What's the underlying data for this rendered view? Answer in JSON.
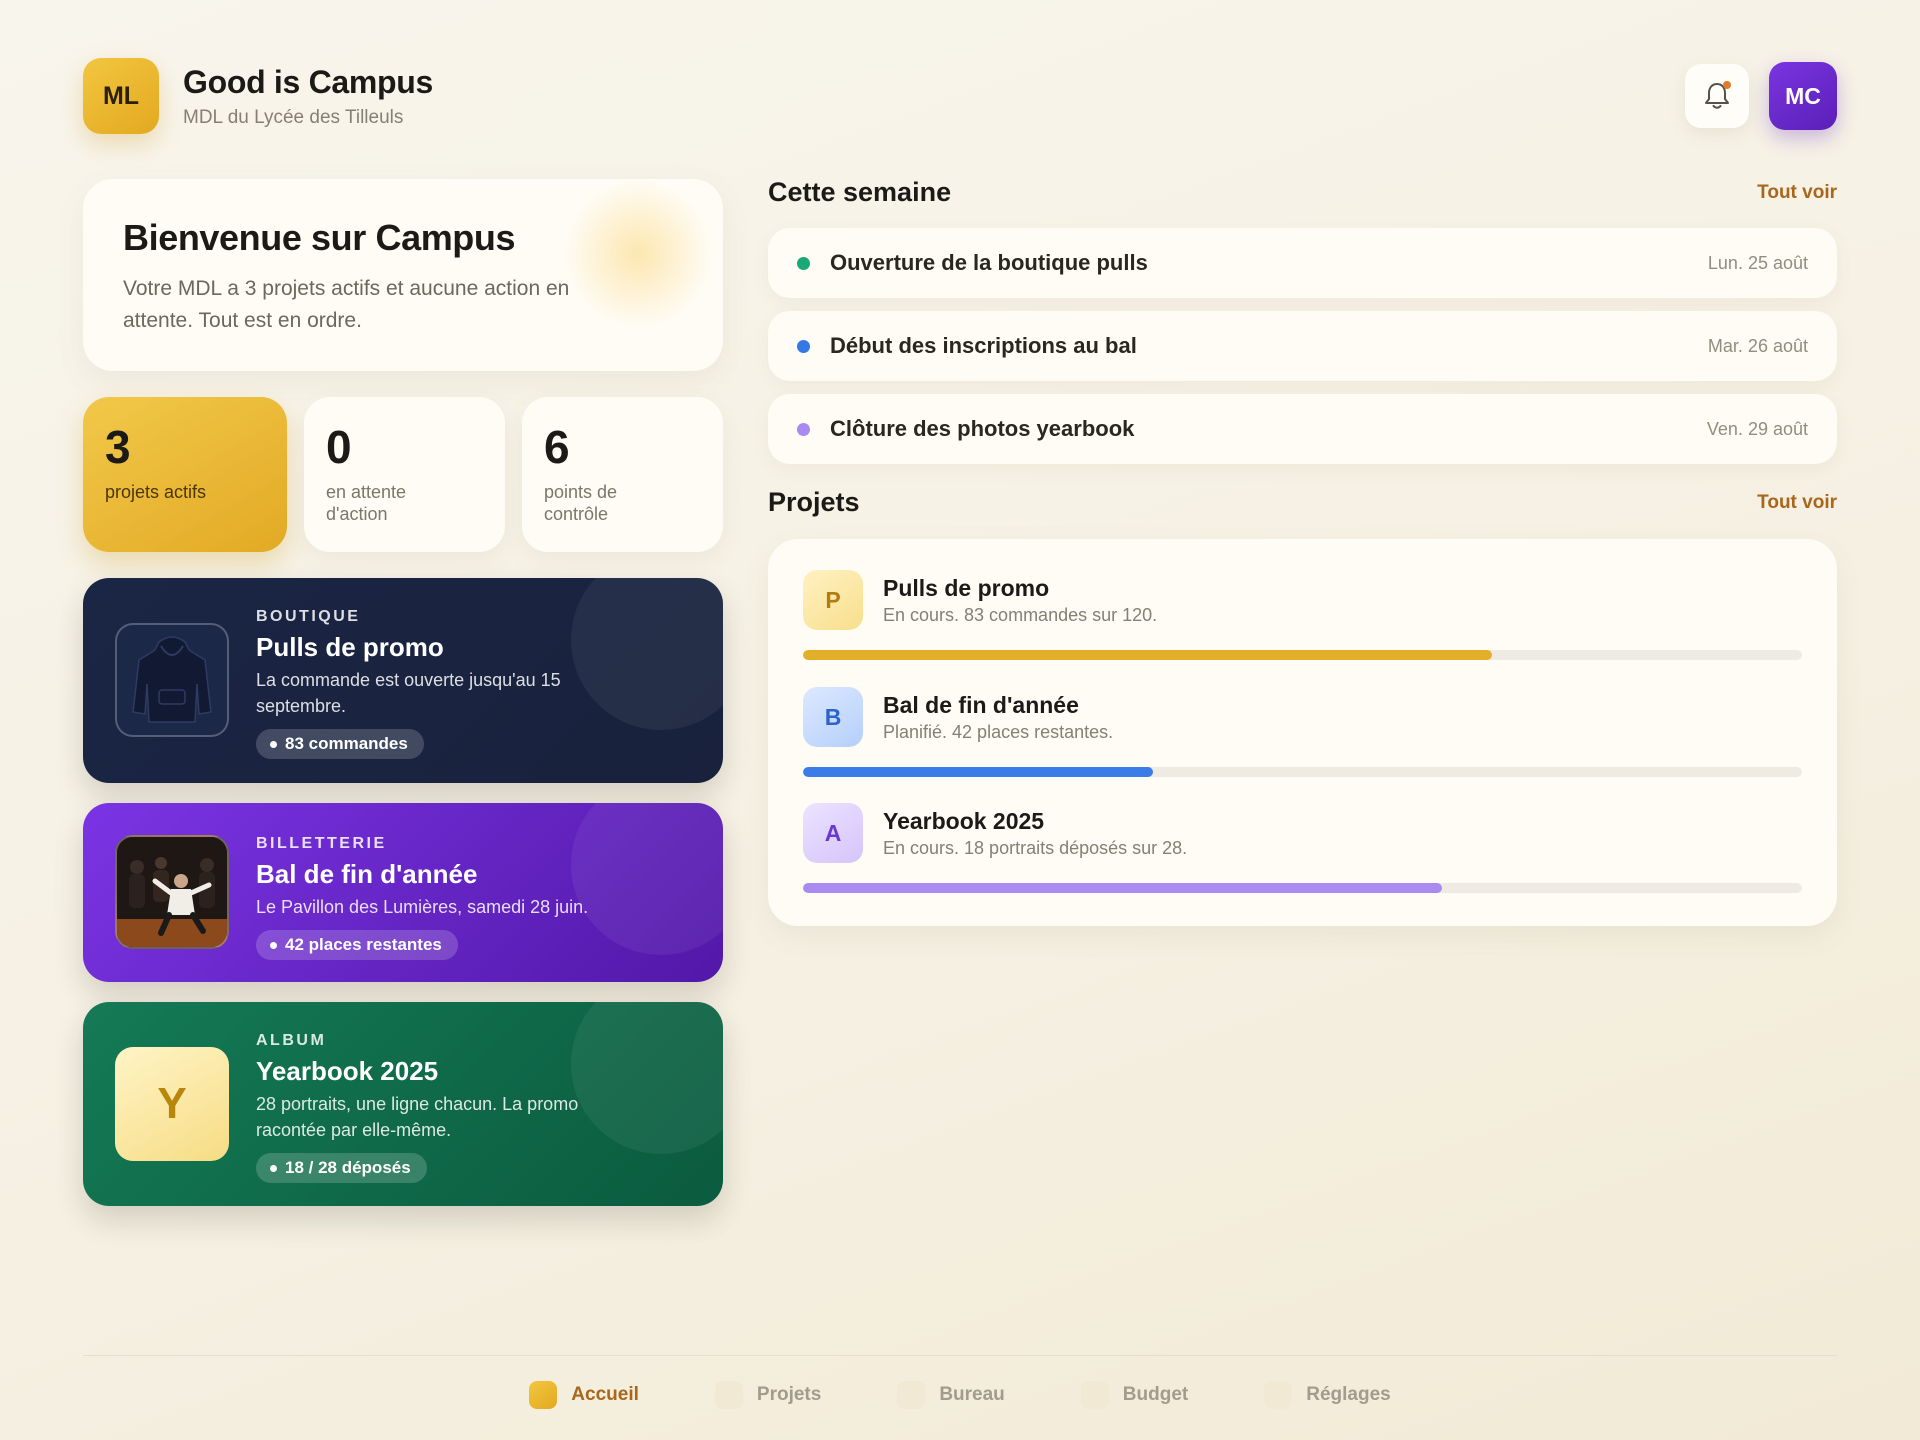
{
  "header": {
    "logo_initials": "ML",
    "title": "Good is Campus",
    "subtitle": "MDL du Lycée des Tilleuls",
    "bell_icon": "bell-icon",
    "avatar_initials": "MC"
  },
  "welcome": {
    "title": "Bienvenue sur Campus",
    "text": "Votre MDL a 3 projets actifs et aucune action en attente. Tout est en ordre."
  },
  "stats": [
    {
      "value": "3",
      "label": "projets actifs"
    },
    {
      "value": "0",
      "label": "en attente d'action"
    },
    {
      "value": "6",
      "label": "points de contrôle"
    }
  ],
  "features": [
    {
      "kicker": "BOUTIQUE",
      "title": "Pulls de promo",
      "desc": "La commande est ouverte jusqu'au 15 septembre.",
      "pill": "83 commandes",
      "thumb": "hoodie-image"
    },
    {
      "kicker": "BILLETTERIE",
      "title": "Bal de fin d'année",
      "desc": "Le Pavillon des Lumières, samedi 28 juin.",
      "pill": "42 places restantes",
      "thumb": "party-photo"
    },
    {
      "kicker": "ALBUM",
      "title": "Yearbook 2025",
      "desc": "28 portraits, une ligne chacun. La promo racontée par elle-même.",
      "pill": "18 / 28 déposés",
      "thumb_letter": "Y"
    }
  ],
  "week": {
    "title": "Cette semaine",
    "see_all": "Tout voir",
    "events": [
      {
        "name": "Ouverture de la boutique pulls",
        "date": "Lun. 25 août",
        "color": "#1aa877"
      },
      {
        "name": "Début des inscriptions au bal",
        "date": "Mar. 26 août",
        "color": "#3478e8"
      },
      {
        "name": "Clôture des photos yearbook",
        "date": "Ven. 29 août",
        "color": "#a98af0"
      }
    ]
  },
  "projects": {
    "title": "Projets",
    "see_all": "Tout voir",
    "items": [
      {
        "letter": "P",
        "name": "Pulls de promo",
        "status": "En cours. 83 commandes sur 120.",
        "progress": 0.69,
        "color": "#e3af2a"
      },
      {
        "letter": "B",
        "name": "Bal de fin d'année",
        "status": "Planifié. 42 places restantes.",
        "progress": 0.35,
        "color": "#3b7de8"
      },
      {
        "letter": "A",
        "name": "Yearbook 2025",
        "status": "En cours. 18 portraits déposés sur 28.",
        "progress": 0.64,
        "color": "#a98af0"
      }
    ]
  },
  "nav": [
    {
      "label": "Accueil",
      "active": true
    },
    {
      "label": "Projets"
    },
    {
      "label": "Bureau"
    },
    {
      "label": "Budget"
    },
    {
      "label": "Réglages"
    }
  ]
}
